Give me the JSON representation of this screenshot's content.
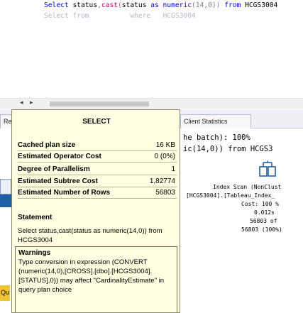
{
  "editor": {
    "sql_line1": {
      "kw_select": "Select",
      "col_status": "status",
      "fn_cast": "cast",
      "arg_open": "(",
      "arg_status": "status",
      "kw_as": "as",
      "type_numeric": "numeric",
      "type_args": "(14,0))",
      "kw_from": "from",
      "table": "HCGS3004"
    },
    "sql_line2": "Select from          where   HCGS3004"
  },
  "tabs": {
    "results": "Re",
    "client_statistics": "Client Statistics"
  },
  "plan": {
    "query_line1": "he batch): 100%",
    "query_line2": "ic(14,0)) from HCGS3",
    "operator": {
      "icon": "index-scan-icon",
      "title": "Index Scan (NonClust",
      "object": "[HCGS3004].[Tableau_Index_",
      "cost": "Cost: 100 %",
      "time": "0.012s",
      "rows_line1": "56803 of",
      "rows_line2": "56803 (100%)"
    }
  },
  "statusbar": {
    "label": "Qu"
  },
  "tooltip": {
    "title": "SELECT",
    "rows": [
      {
        "label": "Cached plan size",
        "value": "16 KB"
      },
      {
        "label": "Estimated Operator Cost",
        "value": "0 (0%)"
      },
      {
        "label": "Degree of Parallelism",
        "value": "1"
      },
      {
        "label": "Estimated Subtree Cost",
        "value": "1,82774"
      },
      {
        "label": "Estimated Number of Rows",
        "value": "56803"
      }
    ],
    "statement_heading": "Statement",
    "statement_text": "Select status,cast(status as numeric(14,0)) from HCGS3004",
    "warnings_heading": "Warnings",
    "warnings_text": "Type conversion in expression (CONVERT (numeric(14,0),[CROSS].[dbo].[HCGS3004].[STATUS],0)) may affect \"CardinalityEstimate\" in query plan choice"
  },
  "colors": {
    "keyword": "#0000ff",
    "function": "#d1006a",
    "tooltip_bg": "#ffffe1",
    "warning_border": "#e23a3a"
  }
}
